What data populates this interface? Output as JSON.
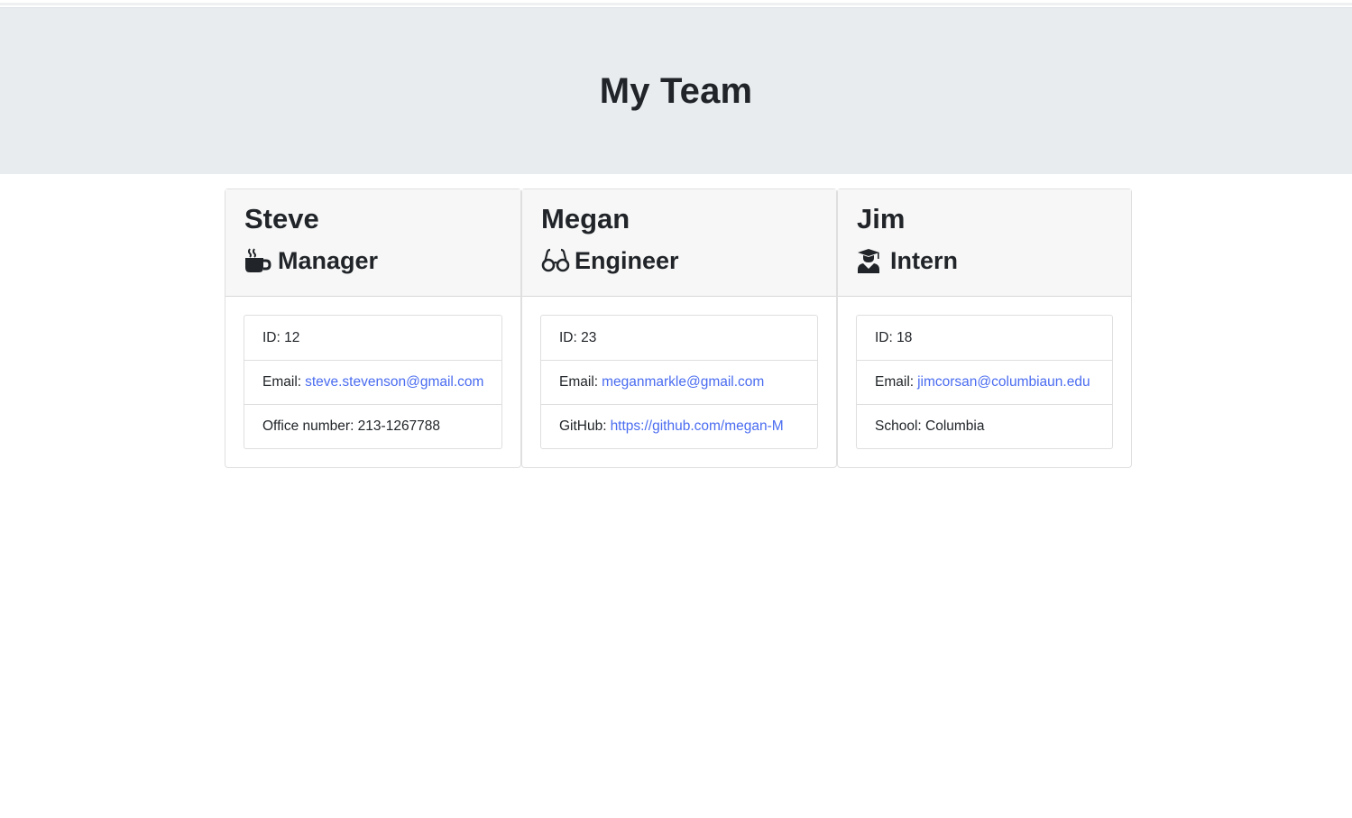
{
  "page": {
    "title": "My Team"
  },
  "team": [
    {
      "name": "Steve",
      "role": "Manager",
      "role_icon": "coffee-icon",
      "id_label": "ID: 12",
      "email_prefix": "Email:",
      "email": "steve.stevenson@gmail.com",
      "extra_prefix": "Office number: 213-1267788",
      "extra_link": ""
    },
    {
      "name": "Megan",
      "role": "Engineer",
      "role_icon": "glasses-icon",
      "id_label": "ID: 23",
      "email_prefix": "Email:",
      "email": "meganmarkle@gmail.com",
      "extra_prefix": "GitHub:",
      "extra_link": "https://github.com/megan-M"
    },
    {
      "name": "Jim",
      "role": "Intern",
      "role_icon": "graduate-icon",
      "id_label": "ID: 18",
      "email_prefix": "Email:",
      "email": "jimcorsan@columbiaun.edu",
      "extra_prefix": "School: Columbia",
      "extra_link": ""
    }
  ],
  "colors": {
    "jumbotron_bg": "#e9ecef",
    "link": "#4a6cf0",
    "header_bg": "#f7f7f7"
  }
}
